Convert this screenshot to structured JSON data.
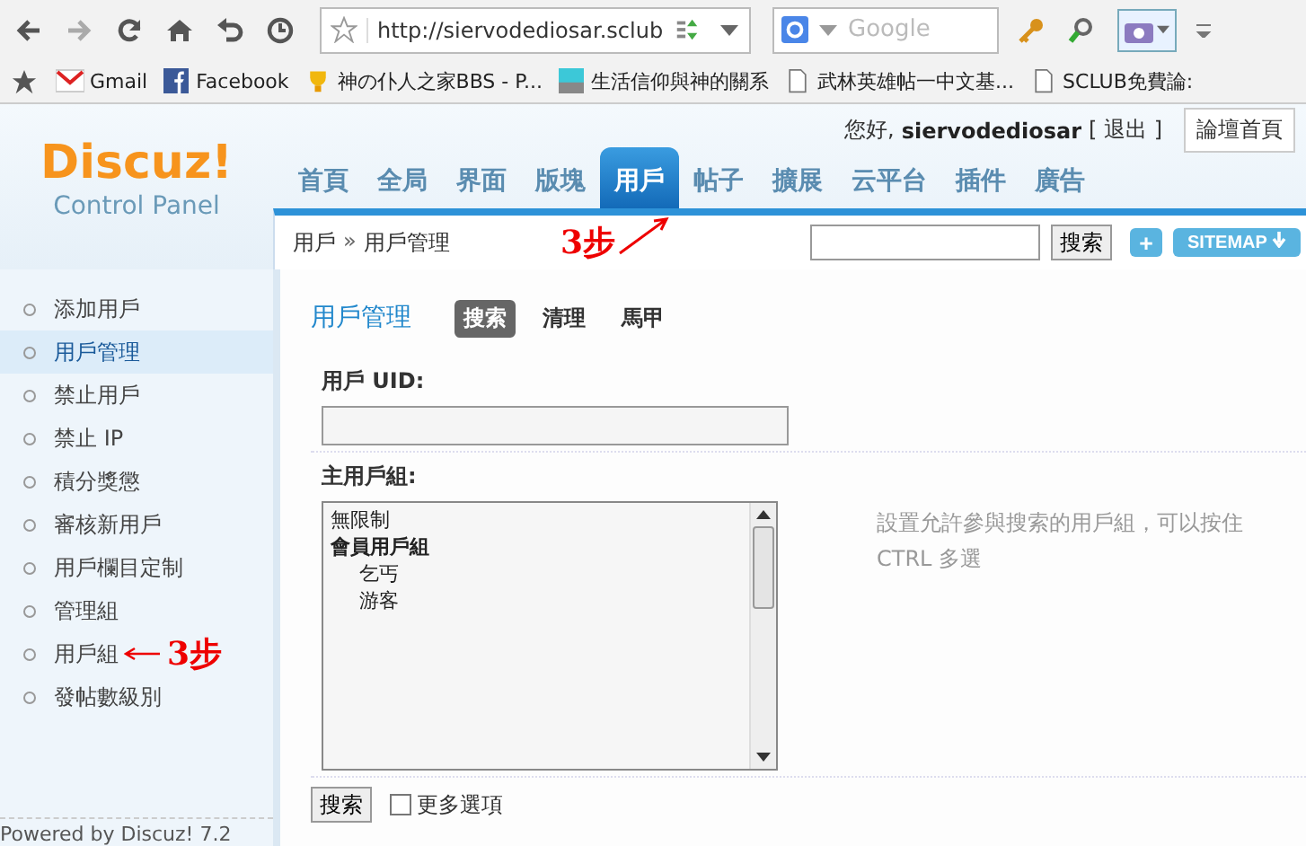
{
  "browser": {
    "url": "http://siervodediosar.sclub",
    "search_placeholder": "Google",
    "bookmarks": [
      {
        "label": "Gmail",
        "kind": "mail"
      },
      {
        "label": "Facebook",
        "kind": "facebook"
      },
      {
        "label": "神の仆人之家BBS - P...",
        "kind": "trophy"
      },
      {
        "label": "生活信仰與神的關系",
        "kind": "image"
      },
      {
        "label": "武林英雄帖一中文基...",
        "kind": "page"
      },
      {
        "label": "SCLUB免費論:",
        "kind": "page"
      }
    ]
  },
  "logo": {
    "name": "Discuz!",
    "subtitle": "Control Panel"
  },
  "nav": [
    {
      "label": "首頁",
      "selected": false
    },
    {
      "label": "全局",
      "selected": false
    },
    {
      "label": "界面",
      "selected": false
    },
    {
      "label": "版塊",
      "selected": false
    },
    {
      "label": "用戶",
      "selected": true
    },
    {
      "label": "帖子",
      "selected": false
    },
    {
      "label": "擴展",
      "selected": false
    },
    {
      "label": "云平台",
      "selected": false
    },
    {
      "label": "插件",
      "selected": false
    },
    {
      "label": "廣告",
      "selected": false
    }
  ],
  "nav_annotation": "3步",
  "user": {
    "greeting": "您好,",
    "name": "siervodediosar",
    "logout": "[ 退出 ]",
    "home_link": "論壇首頁"
  },
  "breadcrumb": {
    "items": [
      "用戶",
      "用戶管理"
    ],
    "separator": "»"
  },
  "top_search": {
    "button": "搜索",
    "add": "+",
    "sitemap": "SITEMAP"
  },
  "sidebar": [
    {
      "label": "添加用戶",
      "selected": false
    },
    {
      "label": "用戶管理",
      "selected": true
    },
    {
      "label": "禁止用戶",
      "selected": false
    },
    {
      "label": "禁止 IP",
      "selected": false
    },
    {
      "label": "積分獎懲",
      "selected": false
    },
    {
      "label": "審核新用戶",
      "selected": false
    },
    {
      "label": "用戶欄目定制",
      "selected": false
    },
    {
      "label": "管理組",
      "selected": false
    },
    {
      "label": "用戶組",
      "selected": false,
      "annotation": "3步"
    },
    {
      "label": "發帖數級別",
      "selected": false
    }
  ],
  "powered_by": "Powered by Discuz! 7.2",
  "content": {
    "title": "用戶管理",
    "tabs": [
      {
        "label": "搜索",
        "selected": true
      },
      {
        "label": "清理",
        "selected": false
      },
      {
        "label": "馬甲",
        "selected": false
      }
    ],
    "uid_label": "用戶 UID:",
    "group_label": "主用戶組:",
    "groups": [
      {
        "label": "無限制",
        "kind": "option"
      },
      {
        "label": "會員用戶組",
        "kind": "heading"
      },
      {
        "label": "乞丐",
        "kind": "child"
      },
      {
        "label": "游客",
        "kind": "child"
      }
    ],
    "group_hint": "設置允許參與搜索的用戶組，可以按住 CTRL 多選",
    "submit": "搜索",
    "more_options": {
      "label": "更多選項",
      "checked": false
    }
  }
}
